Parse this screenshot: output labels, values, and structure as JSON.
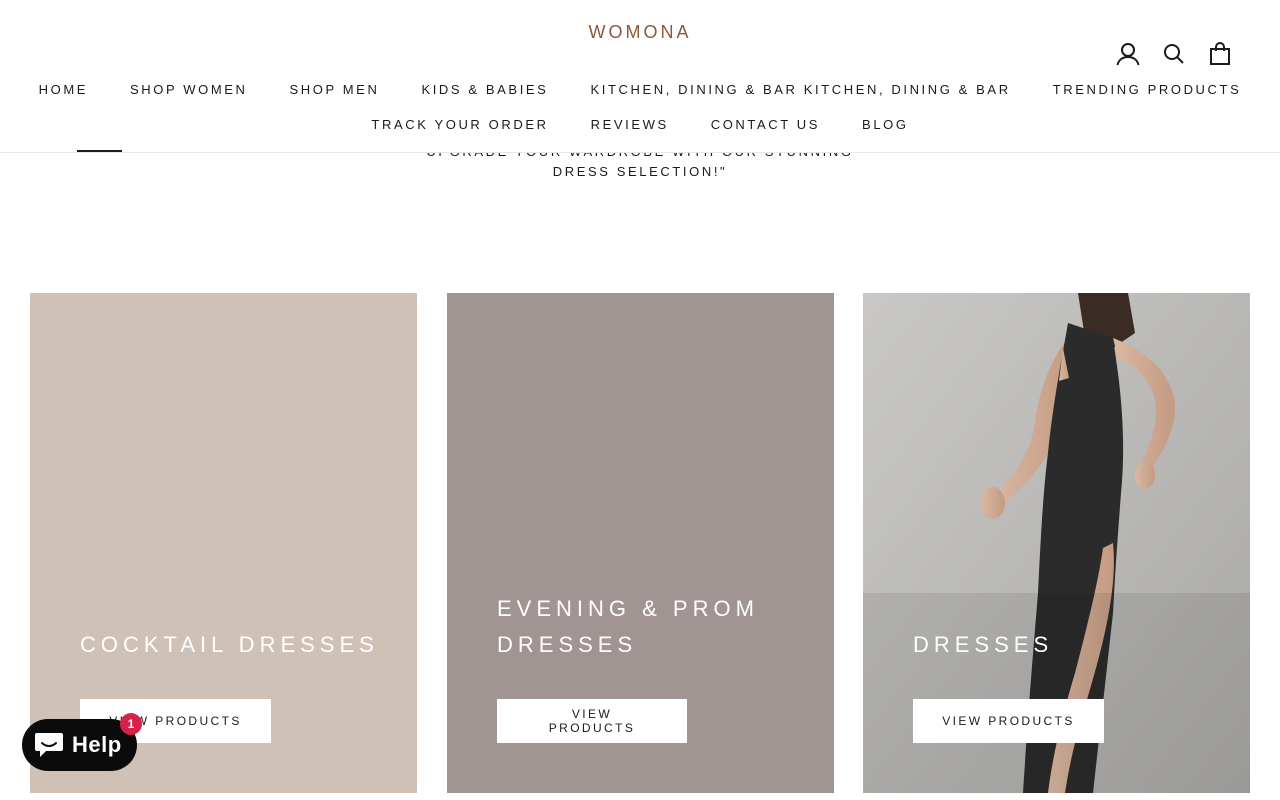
{
  "brand": {
    "logo_text": "WOMONA",
    "logo_color": "#8a5a3c"
  },
  "header": {
    "icons": [
      "account-icon",
      "search-icon",
      "cart-icon"
    ],
    "nav_row1": [
      "HOME",
      "SHOP WOMEN",
      "SHOP MEN",
      "KIDS & BABIES",
      "KITCHEN, DINING & BAR KITCHEN, DINING & BAR",
      "TRENDING PRODUCTS"
    ],
    "nav_row2": [
      "TRACK YOUR ORDER",
      "REVIEWS",
      "CONTACT US",
      "BLOG"
    ],
    "active_item": "HOME"
  },
  "intro": {
    "line1": "UPGRADE YOUR WARDROBE WITH OUR STUNNING",
    "line2": "DRESS SELECTION!\""
  },
  "collections": [
    {
      "title": "COCKTAIL DRESSES",
      "button": "VIEW PRODUCTS",
      "bg": "#cfc1b6"
    },
    {
      "title": "EVENING & PROM DRESSES",
      "button": "VIEW PRODUCTS",
      "bg": "#a19593"
    },
    {
      "title": "DRESSES",
      "button": "VIEW PRODUCTS",
      "bg": "#bdbcba"
    }
  ],
  "help_widget": {
    "label": "Help",
    "badge": "1",
    "badge_color": "#d6224a"
  }
}
